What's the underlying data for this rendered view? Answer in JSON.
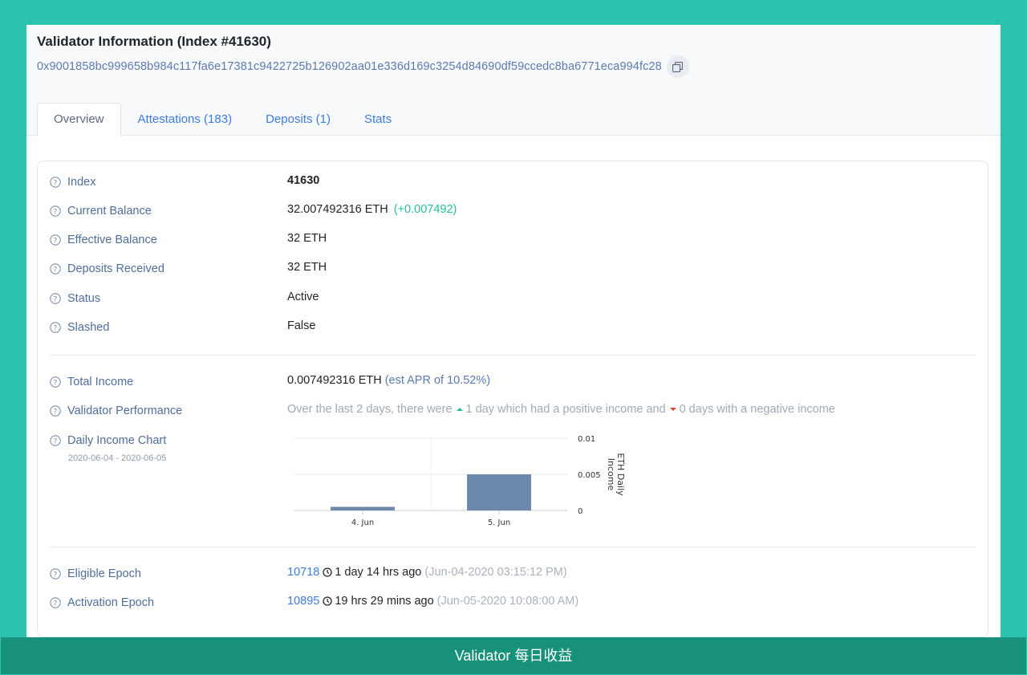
{
  "header": {
    "title": "Validator Information (Index #41630)",
    "address": "0x9001858bc999658b984c117fa6e17381c9422725b126902aa01e336d169c3254d84690df59ccedc8ba6771eca994fc28"
  },
  "tabs": [
    {
      "label": "Overview",
      "active": true
    },
    {
      "label": "Attestations (183)"
    },
    {
      "label": "Deposits (1)"
    },
    {
      "label": "Stats"
    }
  ],
  "overview": {
    "index": {
      "label": "Index",
      "value": "41630"
    },
    "current_balance": {
      "label": "Current Balance",
      "value": "32.007492316 ETH",
      "change": "(+0.007492)"
    },
    "effective_balance": {
      "label": "Effective Balance",
      "value": "32 ETH"
    },
    "deposits_received": {
      "label": "Deposits Received",
      "value": "32 ETH"
    },
    "status": {
      "label": "Status",
      "value": "Active"
    },
    "slashed": {
      "label": "Slashed",
      "value": "False"
    },
    "total_income": {
      "label": "Total Income",
      "value": "0.007492316 ETH",
      "apr": "(est APR of 10.52%)"
    },
    "performance": {
      "label": "Validator Performance",
      "prefix": "Over the last 2 days, there were",
      "positive": "1 day which had a positive income and",
      "negative": "0 days with a negative income"
    },
    "daily_chart": {
      "label": "Daily Income Chart",
      "range": "2020-06-04 - 2020-06-05"
    },
    "eligible_epoch": {
      "label": "Eligible Epoch",
      "epoch": "10718",
      "ago": "1 day 14 hrs ago",
      "date": "(Jun-04-2020 03:15:12 PM)"
    },
    "activation_epoch": {
      "label": "Activation Epoch",
      "epoch": "10895",
      "ago": "19 hrs 29 mins ago",
      "date": "(Jun-05-2020 10:08:00 AM)"
    }
  },
  "colors": {
    "accent": "#3c7be0",
    "positive": "#1fc29a",
    "negative": "#d9463d",
    "bar": "#6c88ad",
    "background": "#2cc4b0"
  },
  "footer": {
    "caption": "Validator 每日收益"
  },
  "chart_data": {
    "type": "bar",
    "categories": [
      "4. Jun",
      "5. Jun"
    ],
    "values": [
      0.0005,
      0.005
    ],
    "ylabel": "ETH Daily Income",
    "ylim": [
      0,
      0.01
    ],
    "yticks": [
      "0",
      "0.005",
      "0.01"
    ],
    "grid": true
  }
}
